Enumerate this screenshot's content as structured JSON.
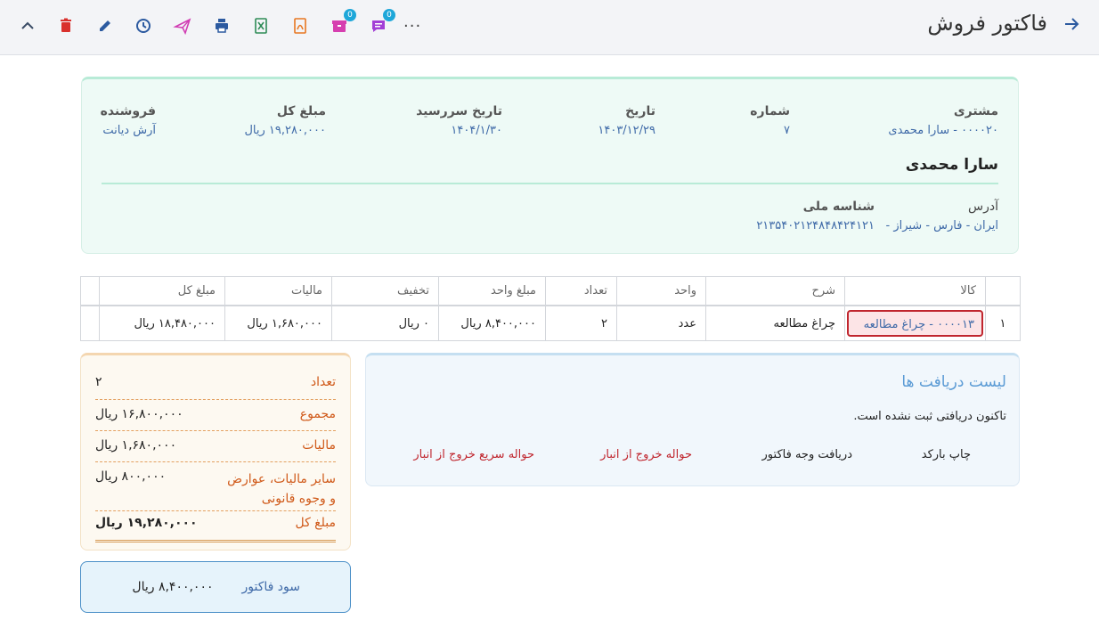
{
  "toolbar": {
    "title": "فاکتور فروش",
    "more_label": "...",
    "badges": {
      "messages": "0",
      "inventory": "0"
    }
  },
  "invoice": {
    "customer_label": "مشتری",
    "customer_value": "۰۰۰۰۲۰ - سارا محمدی",
    "number_label": "شماره",
    "number_value": "۷",
    "date_label": "تاریخ",
    "date_value": "۱۴۰۳/۱۲/۲۹",
    "due_label": "تاریخ سررسید",
    "due_value": "۱۴۰۴/۱/۳۰",
    "total_label": "مبلغ کل",
    "total_value": "۱۹,۲۸۰,۰۰۰ ریال",
    "seller_label": "فروشنده",
    "seller_value": "آرش دیانت",
    "customer_name": "سارا محمدی",
    "address_label": "آدرس",
    "address_value": "ایران - فارس - شیراز -",
    "national_id_label": "شناسه ملی",
    "national_id_value": "۲۱۳۵۴۰۲۱۲۴۸۴۸۴۲۴۱۲۱"
  },
  "table": {
    "headers": [
      "",
      "کالا",
      "شرح",
      "واحد",
      "تعداد",
      "مبلغ واحد",
      "تخفیف",
      "مالیات",
      "مبلغ کل",
      ""
    ],
    "rows": [
      {
        "index": "۱",
        "goods": "۰۰۰۰۱۳ - چراغ مطالعه",
        "description": "چراغ مطالعه",
        "unit": "عدد",
        "qty": "۲",
        "unit_price": "۸,۴۰۰,۰۰۰ ریال",
        "discount": "۰ ریال",
        "tax": "۱,۶۸۰,۰۰۰ ریال",
        "total": "۱۸,۴۸۰,۰۰۰ ریال"
      }
    ]
  },
  "totals": {
    "count_label": "تعداد",
    "count_value": "۲",
    "sum_label": "مجموع",
    "sum_value": "۱۶,۸۰۰,۰۰۰ ریال",
    "tax_label": "مالیات",
    "tax_value": "۱,۶۸۰,۰۰۰ ریال",
    "other_label": "سایر مالیات، عوارض و وجوه قانونی",
    "other_value": "۸۰۰,۰۰۰ ریال",
    "grand_label": "مبلغ کل",
    "grand_value": "۱۹,۲۸۰,۰۰۰ ریال"
  },
  "profit": {
    "label": "سود فاکتور",
    "value": "۸,۴۰۰,۰۰۰ ریال"
  },
  "receipts": {
    "title": "لیست دریافت ها",
    "empty": "تاکنون دریافتی ثبت نشده است.",
    "actions": {
      "print_barcode": "چاپ بارکد",
      "receive_payment": "دریافت وجه فاکتور",
      "warehouse_exit": "حواله خروج از انبار",
      "quick_warehouse_exit": "حواله سریع خروج از انبار"
    }
  },
  "colors": {
    "accent_blue": "#3f6aa8",
    "danger_red": "#c0262e",
    "orange_label": "#d05a1a",
    "receipts_title": "#5b9bd5"
  },
  "icons": [
    "collapse-up-icon",
    "delete-icon",
    "edit-icon",
    "history-icon",
    "send-icon",
    "print-icon",
    "excel-icon",
    "pdf-icon",
    "inventory-icon",
    "message-icon",
    "back-arrow-icon"
  ]
}
